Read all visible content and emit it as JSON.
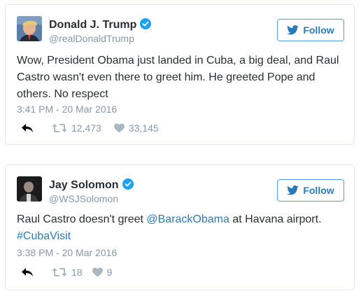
{
  "tweets": [
    {
      "author": "Donald J. Trump",
      "handle": "@realDonaldTrump",
      "follow_label": "Follow",
      "text": "Wow, President Obama just landed in Cuba, a big deal, and Raul Castro wasn't even there to greet him. He greeted Pope and others. No respect",
      "timestamp": "3:41 PM - 20 Mar 2016",
      "retweets": "12,473",
      "likes": "33,145"
    },
    {
      "author": "Jay Solomon",
      "handle": "@WSJSolomon",
      "follow_label": "Follow",
      "text_before": "Raul Castro doesn't greet ",
      "mention": "@BarackObama",
      "text_after": " at Havana airport.",
      "hashtag": "#CubaVisit",
      "timestamp": "3:38 PM - 20 Mar 2016",
      "retweets": "18",
      "likes": "9"
    }
  ],
  "icons": {
    "verified": "verified-badge-icon",
    "follow": "twitter-bird-icon",
    "reply": "reply-icon",
    "retweet": "retweet-icon",
    "like": "heart-icon"
  },
  "colors": {
    "link": "#2b7bb9",
    "muted": "#8899a6",
    "verified": "#1da1f2",
    "border": "#e1e8ed"
  }
}
